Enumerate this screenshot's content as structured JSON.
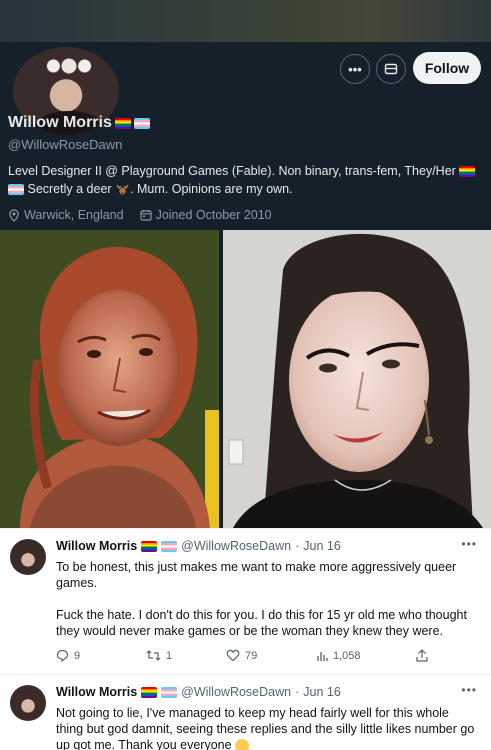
{
  "profile": {
    "name": "Willow Morris",
    "handle": "@WillowRoseDawn",
    "follow_label": "Follow",
    "more_icon": "more-icon",
    "bio_line1": "Level Designer II @ Playground Games (Fable). Non binary, trans-fem, They/Her",
    "bio_line2a": "Secretly a deer",
    "bio_line2b": ". Mum. Opinions are my own.",
    "location": "Warwick, England",
    "joined": "Joined October 2010"
  },
  "tweets": [
    {
      "name": "Willow Morris",
      "handle": "@WillowRoseDawn",
      "dot": "·",
      "date": "Jun 16",
      "body": [
        "To be honest, this just makes me want to make more aggressively queer games.",
        "Fuck the hate. I don't do this for you. I do this for 15 yr old me who thought they would never make games or be the woman they knew they were."
      ],
      "replies": "9",
      "retweets": "1",
      "likes": "79",
      "views": "1,058"
    },
    {
      "name": "Willow Morris",
      "handle": "@WillowRoseDawn",
      "dot": "·",
      "date": "Jun 16",
      "body": [
        "Not going to lie, I've managed to keep my head fairly well for this whole thing but god damnit, seeing these replies and the silly little likes number go up got me. Thank you everyone"
      ]
    }
  ],
  "colors": {
    "background": "#15202b",
    "follow_bg": "#eff3f4",
    "muted": "#8b98a5"
  }
}
